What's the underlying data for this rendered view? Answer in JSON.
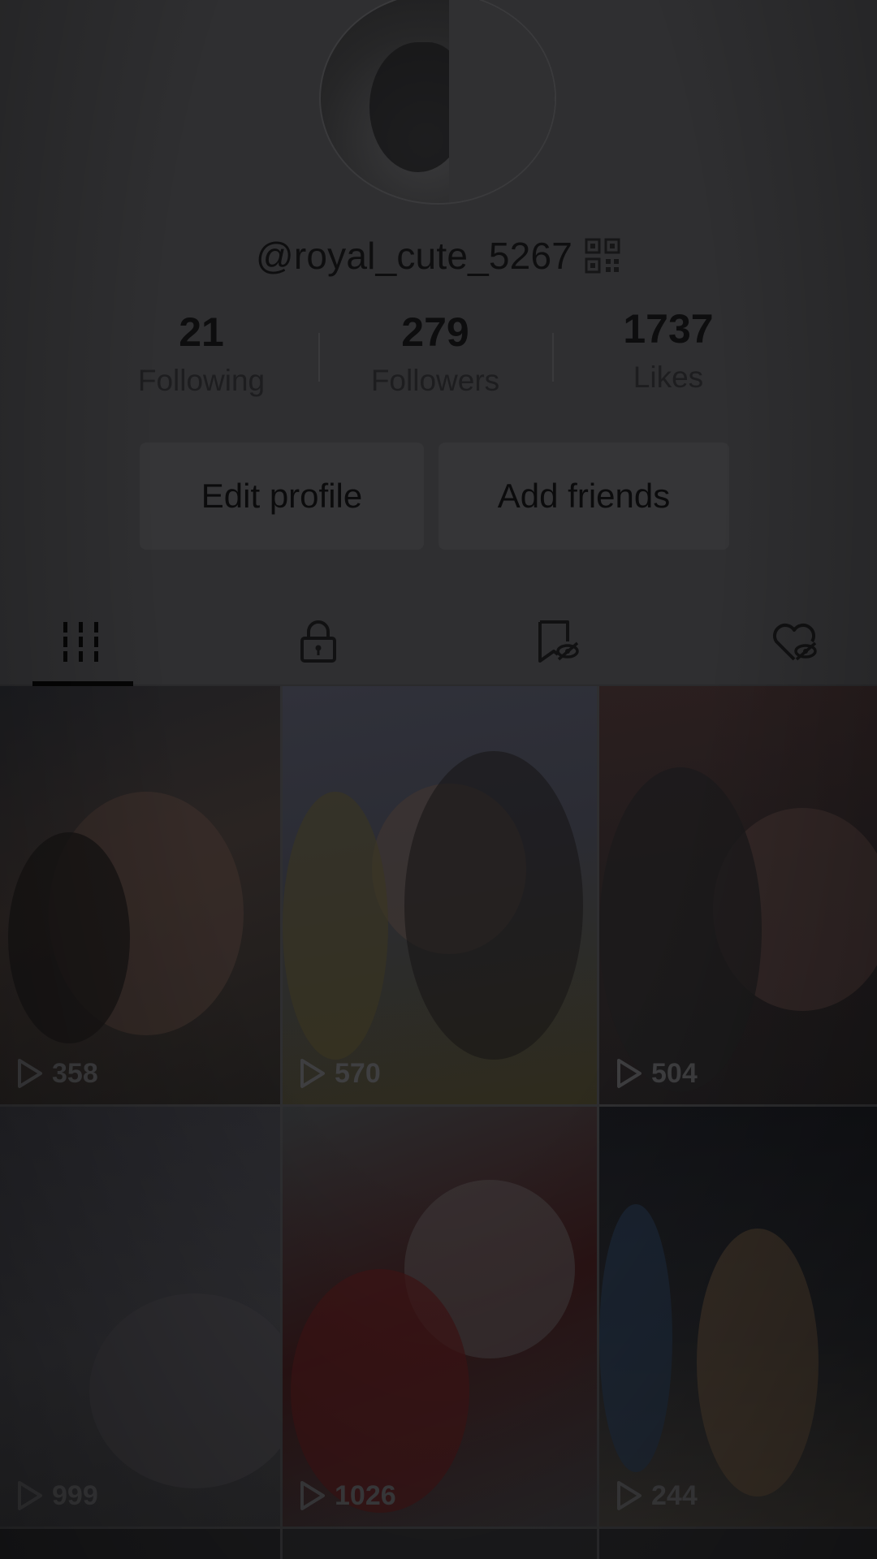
{
  "profile": {
    "username": "@royal_cute_5267",
    "avatar_alt": ""
  },
  "stats": {
    "following": {
      "count": "21",
      "label": "Following"
    },
    "followers": {
      "count": "279",
      "label": "Followers"
    },
    "likes": {
      "count": "1737",
      "label": "Likes"
    }
  },
  "actions": {
    "edit_profile_label": "Edit profile",
    "add_friends_label": "Add friends"
  },
  "tabs": [
    {
      "icon": "grid-icon",
      "selected": true
    },
    {
      "icon": "lock-icon",
      "selected": false
    },
    {
      "icon": "bookmark-icon",
      "selected": false
    },
    {
      "icon": "liked-heart-icon",
      "selected": false
    }
  ],
  "videos": [
    {
      "views": "358"
    },
    {
      "views": "570"
    },
    {
      "views": "504"
    },
    {
      "views": "999"
    },
    {
      "views": "1026"
    },
    {
      "views": "244"
    }
  ],
  "colors": {
    "overlay_dim": "#2f2f31",
    "text_dark": "#0e0e0f",
    "button_bg": "#353537"
  }
}
